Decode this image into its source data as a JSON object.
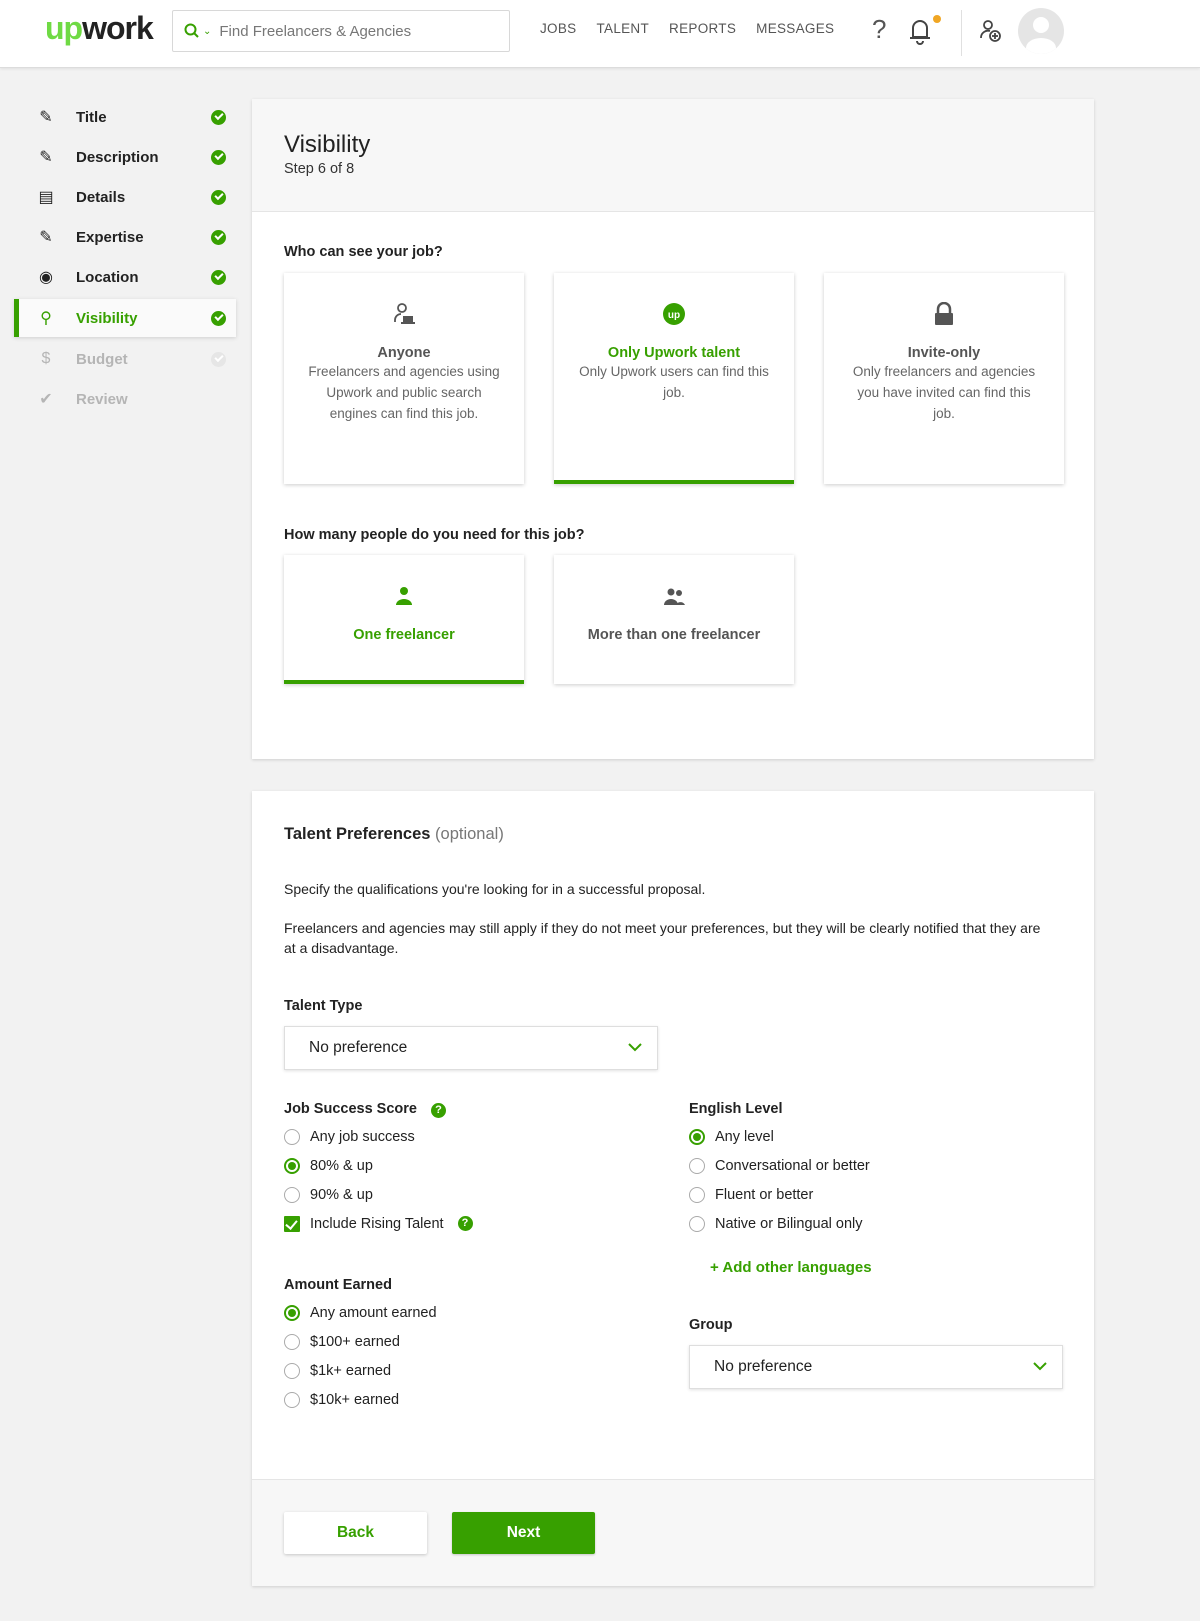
{
  "header": {
    "logo_up": "up",
    "logo_work": "work",
    "search_placeholder": "Find Freelancers & Agencies",
    "nav": [
      "JOBS",
      "TALENT",
      "REPORTS",
      "MESSAGES"
    ],
    "help_label": "?",
    "accent_color": "#37a000",
    "notification_dot_color": "#f0a624"
  },
  "sidebar": {
    "items": [
      {
        "label": "Title",
        "icon": "pencil-icon",
        "state": "complete"
      },
      {
        "label": "Description",
        "icon": "edit-icon",
        "state": "complete"
      },
      {
        "label": "Details",
        "icon": "list-icon",
        "state": "complete"
      },
      {
        "label": "Expertise",
        "icon": "tools-icon",
        "state": "complete"
      },
      {
        "label": "Location",
        "icon": "map-pin-icon",
        "state": "complete"
      },
      {
        "label": "Visibility",
        "icon": "search-user-icon",
        "state": "active-complete"
      },
      {
        "label": "Budget",
        "icon": "dollar-icon",
        "state": "disabled"
      },
      {
        "label": "Review",
        "icon": "checkmark-icon",
        "state": "disabled"
      }
    ]
  },
  "visibility": {
    "title": "Visibility",
    "step": "Step 6 of 8",
    "who_question": "Who can see your job?",
    "who_options": [
      {
        "title": "Anyone",
        "desc": "Freelancers and agencies using Upwork and public search engines can find this job.",
        "selected": false
      },
      {
        "title": "Only Upwork talent",
        "desc": "Only Upwork users can find this job.",
        "selected": true
      },
      {
        "title": "Invite-only",
        "desc": "Only freelancers and agencies you have invited can find this job.",
        "selected": false
      }
    ],
    "people_question": "How many people do you need for this job?",
    "people_options": [
      {
        "title": "One freelancer",
        "selected": true
      },
      {
        "title": "More than one freelancer",
        "selected": false
      }
    ]
  },
  "talent": {
    "title": "Talent Preferences",
    "optional": "(optional)",
    "p1": "Specify the qualifications you're looking for in a successful proposal.",
    "p2": "Freelancers and agencies may still apply if they do not meet your preferences, but they will be clearly notified that they are at a disadvantage.",
    "talent_type_label": "Talent Type",
    "talent_type_value": "No preference",
    "jss_label": "Job Success Score",
    "jss_options": [
      {
        "label": "Any job success",
        "checked": false
      },
      {
        "label": "80% & up",
        "checked": true
      },
      {
        "label": "90% & up",
        "checked": false
      }
    ],
    "rising_talent_label": "Include Rising Talent",
    "rising_talent_checked": true,
    "amount_label": "Amount Earned",
    "amount_options": [
      {
        "label": "Any amount earned",
        "checked": true
      },
      {
        "label": "$100+ earned",
        "checked": false
      },
      {
        "label": "$1k+ earned",
        "checked": false
      },
      {
        "label": "$10k+ earned",
        "checked": false
      }
    ],
    "english_label": "English Level",
    "english_options": [
      {
        "label": "Any level",
        "checked": true
      },
      {
        "label": "Conversational or better",
        "checked": false
      },
      {
        "label": "Fluent or better",
        "checked": false
      },
      {
        "label": "Native or Bilingual only",
        "checked": false
      }
    ],
    "add_languages": "+ Add other languages",
    "group_label": "Group",
    "group_value": "No preference"
  },
  "footer": {
    "back_label": "Back",
    "next_label": "Next"
  }
}
